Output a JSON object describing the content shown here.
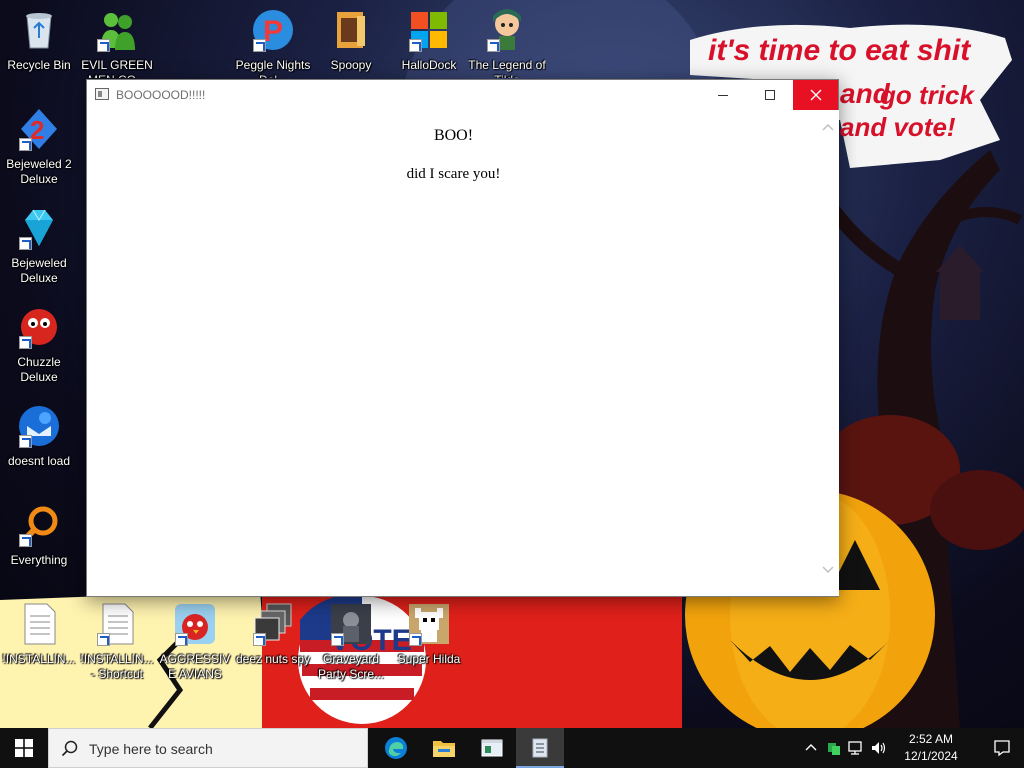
{
  "wallpaper": {
    "caption_line1": "it's time to eat shit",
    "caption_line2a": "and",
    "caption_line2b": "go trick",
    "caption_line3": "and vote!"
  },
  "desktop_icons": [
    {
      "label": "Recycle Bin",
      "icon": "recycle-bin-icon"
    },
    {
      "label": "EVIL GREEN MEN CO...",
      "icon": "green-men-icon"
    },
    {
      "label": "Peggle Nights Del...",
      "icon": "peggle-icon"
    },
    {
      "label": "Spoopy",
      "icon": "spoopy-folder-icon"
    },
    {
      "label": "HalloDock",
      "icon": "windows-logo-icon"
    },
    {
      "label": "The Legend of Tilda",
      "icon": "legend-character-icon"
    },
    {
      "label": "Bejeweled 2 Deluxe",
      "icon": "bejeweled-2-icon"
    },
    {
      "label": "Bejeweled Deluxe",
      "icon": "diamond-icon"
    },
    {
      "label": "Chuzzle Deluxe",
      "icon": "chuzzle-icon"
    },
    {
      "label": "doesnt load",
      "icon": "thunderbird-icon"
    },
    {
      "label": "Everything",
      "icon": "magnifier-icon"
    },
    {
      "label": "!INSTALLIN...",
      "icon": "text-file-icon"
    },
    {
      "label": "!INSTALLIN... - Shortcut",
      "icon": "text-file-icon"
    },
    {
      "label": "AGGRESSIVE AVIANS",
      "icon": "angry-bird-icon"
    },
    {
      "label": "deez nuts spy",
      "icon": "windows-stack-icon"
    },
    {
      "label": "Graveyard Party Scre...",
      "icon": "graveyard-icon"
    },
    {
      "label": "Super Hilda",
      "icon": "pixel-dog-icon"
    }
  ],
  "window": {
    "title": "BOOOOOOD!!!!!",
    "heading": "BOO!",
    "body": "did I scare you!",
    "close_color": "#e81123"
  },
  "taskbar": {
    "search_placeholder": "Type here to search",
    "pinned_apps": [
      "edge-icon",
      "file-explorer-icon",
      "window-app-icon",
      "notepad-app-icon"
    ],
    "clock_time": "2:52 AM",
    "clock_date": "12/1/2024"
  }
}
